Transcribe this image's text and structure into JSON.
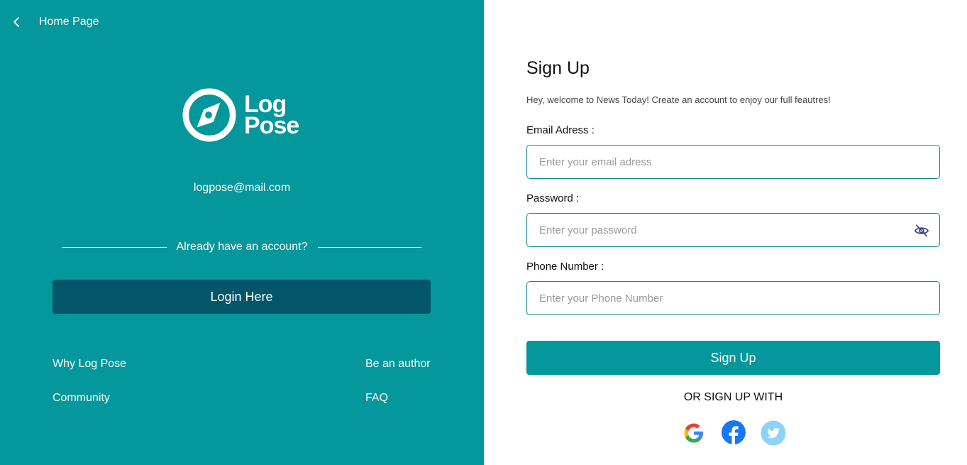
{
  "left": {
    "back_label": "Home Page",
    "brand": {
      "line1": "Log",
      "line2": "Pose"
    },
    "email": "logpose@mail.com",
    "divider_text": "Already have an account?",
    "login_button": "Login Here",
    "links": {
      "why": "Why Log Pose",
      "author": "Be an author",
      "community": "Community",
      "faq": "FAQ"
    }
  },
  "form": {
    "title": "Sign Up",
    "subtitle": "Hey, welcome to News Today! Create an account to enjoy our full feautres!",
    "email_label": "Email Adress :",
    "email_placeholder": "Enter your email adress",
    "password_label": "Password :",
    "password_placeholder": "Enter your password",
    "phone_label": "Phone Number :",
    "phone_placeholder": "Enter your Phone Number",
    "submit": "Sign Up",
    "or_text": "OR SIGN UP WITH"
  },
  "socials": [
    "google-icon",
    "facebook-icon",
    "twitter-icon"
  ],
  "colors": {
    "teal": "#04979b",
    "dark_teal": "#03566a",
    "twitter": "#8ed3f7",
    "facebook": "#1877f2"
  }
}
